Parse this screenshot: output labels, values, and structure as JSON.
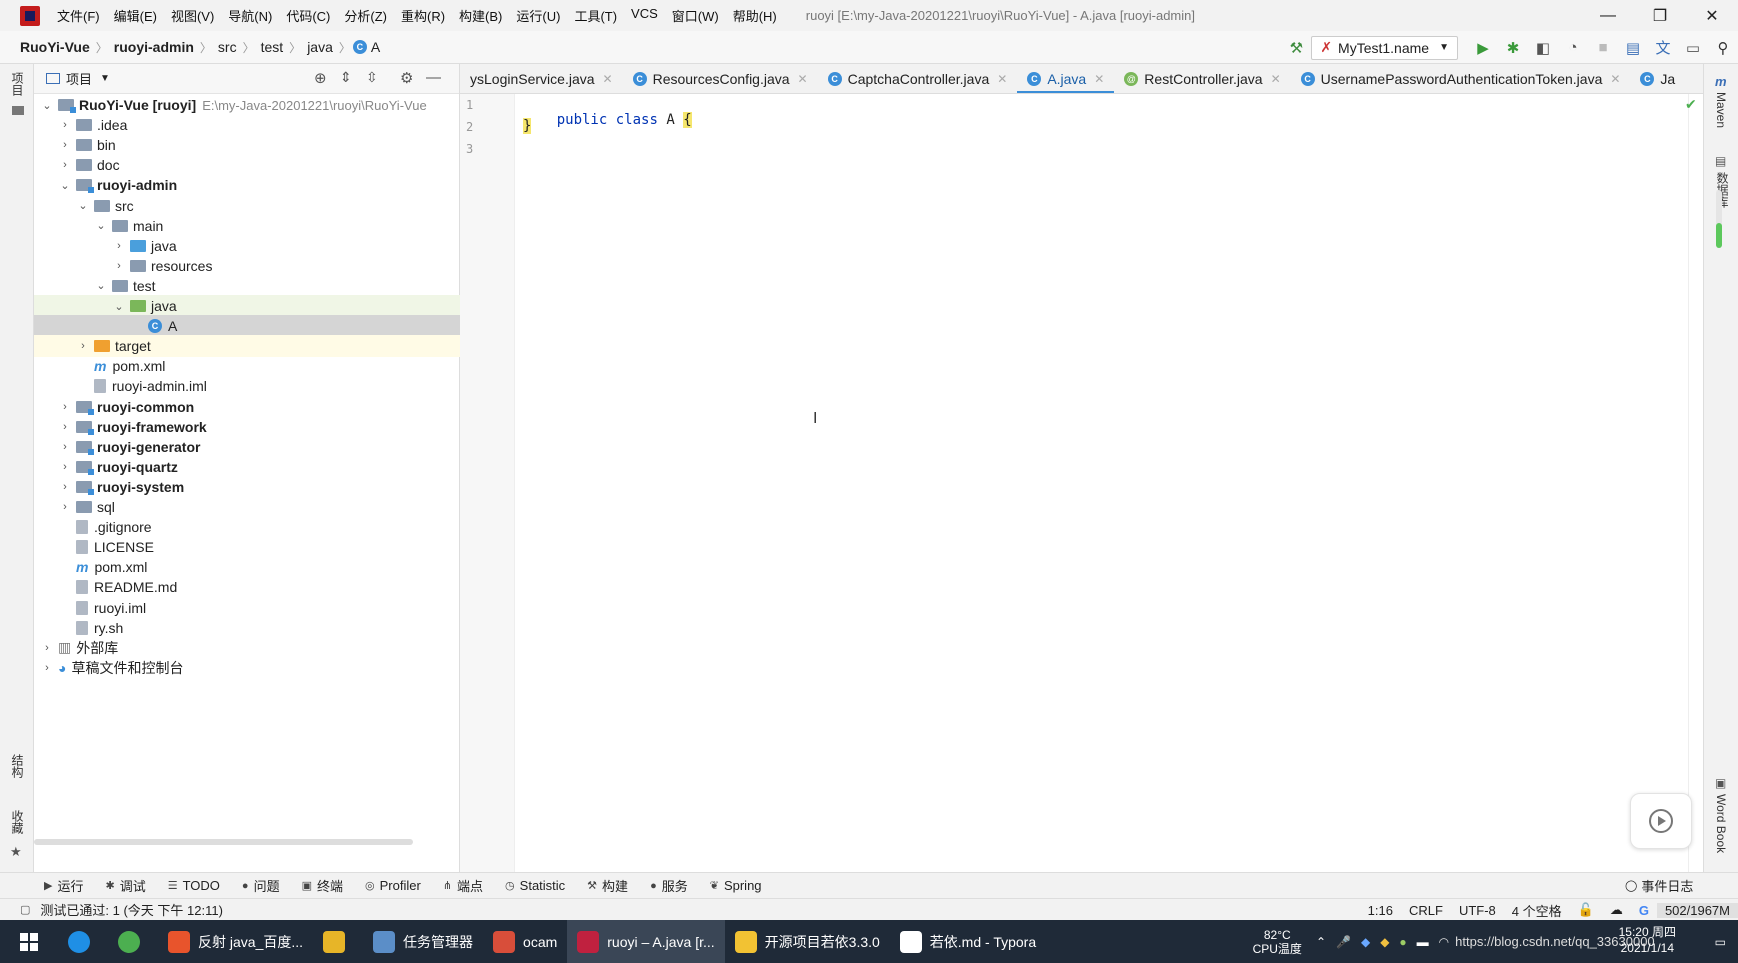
{
  "window": {
    "menu": [
      "文件(F)",
      "编辑(E)",
      "视图(V)",
      "导航(N)",
      "代码(C)",
      "分析(Z)",
      "重构(R)",
      "构建(B)",
      "运行(U)",
      "工具(T)",
      "VCS",
      "窗口(W)",
      "帮助(H)"
    ],
    "title": "ruoyi [E:\\my-Java-20201221\\ruoyi\\RuoYi-Vue] - A.java [ruoyi-admin]"
  },
  "breadcrumb": [
    "RuoYi-Vue",
    "ruoyi-admin",
    "src",
    "test",
    "java",
    "A"
  ],
  "run_config": "MyTest1.name",
  "left_strip": {
    "top": "项目",
    "mid": "结构",
    "bottom": "收藏"
  },
  "project": {
    "header": "项目",
    "tree": [
      {
        "label": "RuoYi-Vue [ruoyi]",
        "extra": "E:\\my-Java-20201221\\ruoyi\\RuoYi-Vue",
        "depth": 0,
        "arrow": "v",
        "icon": "module",
        "bold": true
      },
      {
        "label": ".idea",
        "depth": 1,
        "arrow": ">",
        "icon": "folder"
      },
      {
        "label": "bin",
        "depth": 1,
        "arrow": ">",
        "icon": "folder"
      },
      {
        "label": "doc",
        "depth": 1,
        "arrow": ">",
        "icon": "folder"
      },
      {
        "label": "ruoyi-admin",
        "depth": 1,
        "arrow": "v",
        "icon": "module",
        "bold": true
      },
      {
        "label": "src",
        "depth": 2,
        "arrow": "v",
        "icon": "folder"
      },
      {
        "label": "main",
        "depth": 3,
        "arrow": "v",
        "icon": "folder"
      },
      {
        "label": "java",
        "depth": 4,
        "arrow": ">",
        "icon": "blue"
      },
      {
        "label": "resources",
        "depth": 4,
        "arrow": ">",
        "icon": "folder"
      },
      {
        "label": "test",
        "depth": 3,
        "arrow": "v",
        "icon": "folder"
      },
      {
        "label": "java",
        "depth": 4,
        "arrow": "v",
        "icon": "green",
        "state": "highlight"
      },
      {
        "label": "A",
        "depth": 5,
        "arrow": "",
        "icon": "class",
        "state": "selected"
      },
      {
        "label": "target",
        "depth": 2,
        "arrow": ">",
        "icon": "orange",
        "state": "yellow"
      },
      {
        "label": "pom.xml",
        "depth": 2,
        "arrow": "",
        "icon": "maven"
      },
      {
        "label": "ruoyi-admin.iml",
        "depth": 2,
        "arrow": "",
        "icon": "file"
      },
      {
        "label": "ruoyi-common",
        "depth": 1,
        "arrow": ">",
        "icon": "module",
        "bold": true
      },
      {
        "label": "ruoyi-framework",
        "depth": 1,
        "arrow": ">",
        "icon": "module",
        "bold": true
      },
      {
        "label": "ruoyi-generator",
        "depth": 1,
        "arrow": ">",
        "icon": "module",
        "bold": true
      },
      {
        "label": "ruoyi-quartz",
        "depth": 1,
        "arrow": ">",
        "icon": "module",
        "bold": true
      },
      {
        "label": "ruoyi-system",
        "depth": 1,
        "arrow": ">",
        "icon": "module",
        "bold": true
      },
      {
        "label": "sql",
        "depth": 1,
        "arrow": ">",
        "icon": "folder"
      },
      {
        "label": ".gitignore",
        "depth": 1,
        "arrow": "",
        "icon": "file"
      },
      {
        "label": "LICENSE",
        "depth": 1,
        "arrow": "",
        "icon": "file"
      },
      {
        "label": "pom.xml",
        "depth": 1,
        "arrow": "",
        "icon": "maven"
      },
      {
        "label": "README.md",
        "depth": 1,
        "arrow": "",
        "icon": "file"
      },
      {
        "label": "ruoyi.iml",
        "depth": 1,
        "arrow": "",
        "icon": "file"
      },
      {
        "label": "ry.sh",
        "depth": 1,
        "arrow": "",
        "icon": "file"
      },
      {
        "label": "外部库",
        "depth": 0,
        "arrow": ">",
        "icon": "lib"
      },
      {
        "label": "草稿文件和控制台",
        "depth": 0,
        "arrow": ">",
        "icon": "scratch"
      }
    ]
  },
  "tabs": [
    {
      "label": "ysLoginService.java",
      "icon": "",
      "active": false
    },
    {
      "label": "ResourcesConfig.java",
      "icon": "C",
      "active": false
    },
    {
      "label": "CaptchaController.java",
      "icon": "C",
      "active": false
    },
    {
      "label": "A.java",
      "icon": "C",
      "active": true
    },
    {
      "label": "RestController.java",
      "icon": "@",
      "active": false
    },
    {
      "label": "UsernamePasswordAuthenticationToken.java",
      "icon": "C",
      "active": false
    },
    {
      "label": "Ja",
      "icon": "C",
      "active": false
    }
  ],
  "editor": {
    "line_numbers": [
      "1",
      "2",
      "3"
    ],
    "code": {
      "kw1": "public",
      "kw2": "class",
      "name": "A",
      "open": "{",
      "close": "}"
    }
  },
  "right_strip": [
    "Maven",
    "数据库",
    "Word Book"
  ],
  "bottom_tools": [
    {
      "icon": "▶",
      "label": "运行"
    },
    {
      "icon": "✱",
      "label": "调试"
    },
    {
      "icon": "☰",
      "label": "TODO"
    },
    {
      "icon": "●",
      "label": "问题"
    },
    {
      "icon": "▣",
      "label": "终端"
    },
    {
      "icon": "◎",
      "label": "Profiler"
    },
    {
      "icon": "⋔",
      "label": "端点"
    },
    {
      "icon": "◷",
      "label": "Statistic"
    },
    {
      "icon": "⚒",
      "label": "构建"
    },
    {
      "icon": "●",
      "label": "服务"
    },
    {
      "icon": "❦",
      "label": "Spring"
    }
  ],
  "event_log": "事件日志",
  "status": {
    "message": "测试已通过: 1 (今天 下午 12:11)",
    "position": "1:16",
    "line_sep": "CRLF",
    "encoding": "UTF-8",
    "indent": "4 个空格",
    "memory": "502/1967M"
  },
  "taskbar": {
    "apps": [
      {
        "label": "反射 java_百度...",
        "color": "#e8542c",
        "active": false
      },
      {
        "label": "",
        "color": "#e7b528",
        "active": false
      },
      {
        "label": "任务管理器",
        "color": "#5b8ec8",
        "active": false
      },
      {
        "label": "ocam",
        "color": "#d84e3a",
        "active": false
      },
      {
        "label": "ruoyi – A.java [r...",
        "color": "#c0213f",
        "active": true
      },
      {
        "label": "开源项目若依3.3.0",
        "color": "#f2c233",
        "active": false
      },
      {
        "label": "若依.md - Typora",
        "color": "#ffffff",
        "active": false
      }
    ],
    "temp": "82°C",
    "temp_label": "CPU温度",
    "time": "15:20 周四",
    "date": "2021/1/14",
    "overlay": "https://blog.csdn.net/qq_33630000"
  },
  "colors": {
    "accent": "#3b8ed8",
    "keyword": "#0033b3",
    "selected_row": "#d5d5d5",
    "taskbar": "#1f2a38"
  }
}
